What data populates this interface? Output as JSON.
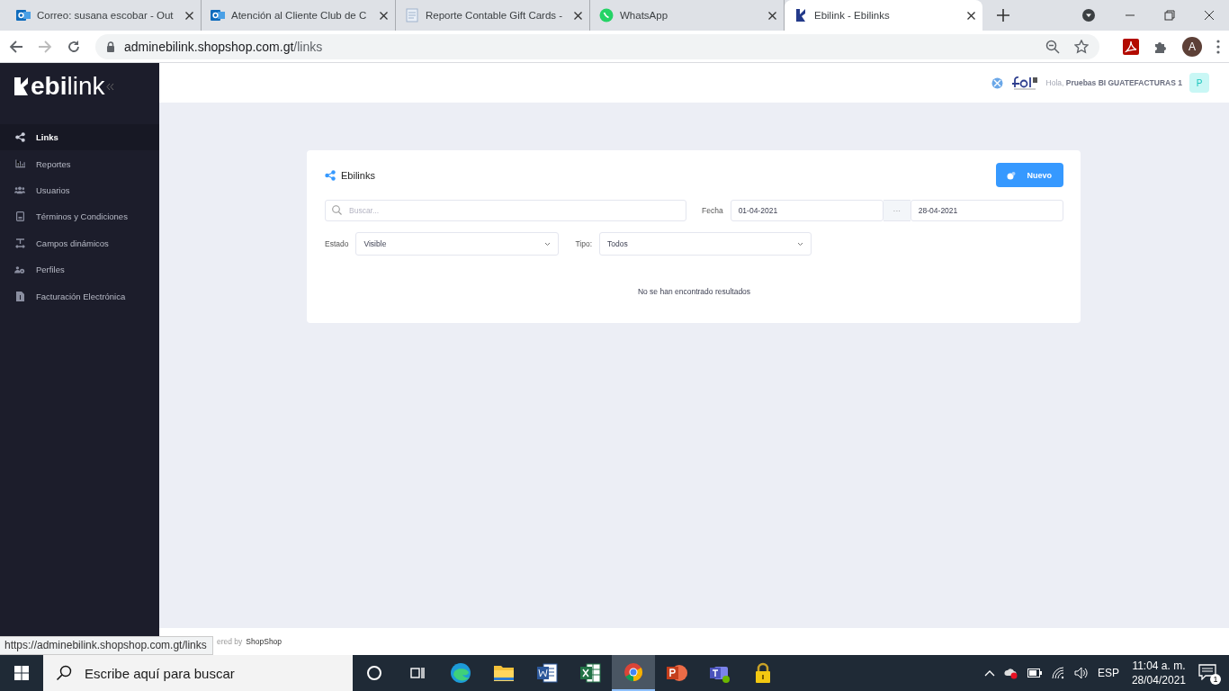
{
  "browser": {
    "tabs": [
      {
        "title": "Correo: susana escobar - Out",
        "selected": false
      },
      {
        "title": "Atención al Cliente Club de C",
        "selected": false
      },
      {
        "title": "Reporte Contable Gift Cards -",
        "selected": false
      },
      {
        "title": "WhatsApp",
        "selected": false
      },
      {
        "title": "Ebilink - Ebilinks",
        "selected": true
      }
    ],
    "url_host": "adminebilink.shopshop.com.gt",
    "url_path": "/links",
    "profile": "A"
  },
  "sidebar": {
    "logo": {
      "bold": "ebi",
      "light": "link"
    },
    "items": [
      {
        "label": "Links",
        "selected": true
      },
      {
        "label": "Reportes",
        "selected": false
      },
      {
        "label": "Usuarios",
        "selected": false
      },
      {
        "label": "Términos y Condiciones",
        "selected": false
      },
      {
        "label": "Campos dinámicos",
        "selected": false
      },
      {
        "label": "Perfiles",
        "selected": false
      },
      {
        "label": "Facturación Electrónica",
        "selected": false
      }
    ]
  },
  "header": {
    "greeting": "Hola,",
    "user": "Pruebas BI GUATEFACTURAS 1",
    "avatar": "P"
  },
  "card": {
    "title": "Ebilinks",
    "new_button": "Nuevo",
    "search": {
      "placeholder": "Buscar..."
    },
    "date_label": "Fecha",
    "date_from": "01-04-2021",
    "date_sep": "···",
    "date_to": "28-04-2021",
    "estado_label": "Estado",
    "estado": "Visible",
    "tipo_label": "Tipo:",
    "tipo": "Todos",
    "empty": "No se han encontrado resultados"
  },
  "footer": {
    "text": "ered by",
    "brand": "ShopShop"
  },
  "status_url": "https://adminebilink.shopshop.com.gt/links",
  "taskbar": {
    "search": {
      "placeholder": "Escribe aquí para buscar"
    },
    "apps": [
      {
        "selected": false
      },
      {
        "selected": false
      },
      {
        "selected": false
      },
      {
        "selected": false
      },
      {
        "selected": false
      },
      {
        "selected": false
      },
      {
        "selected": true
      },
      {
        "selected": false
      },
      {
        "selected": false
      },
      {
        "selected": false
      }
    ],
    "language": "ESP",
    "time": "11:04 a. m.",
    "date": "28/04/2021",
    "notifications": "1"
  }
}
